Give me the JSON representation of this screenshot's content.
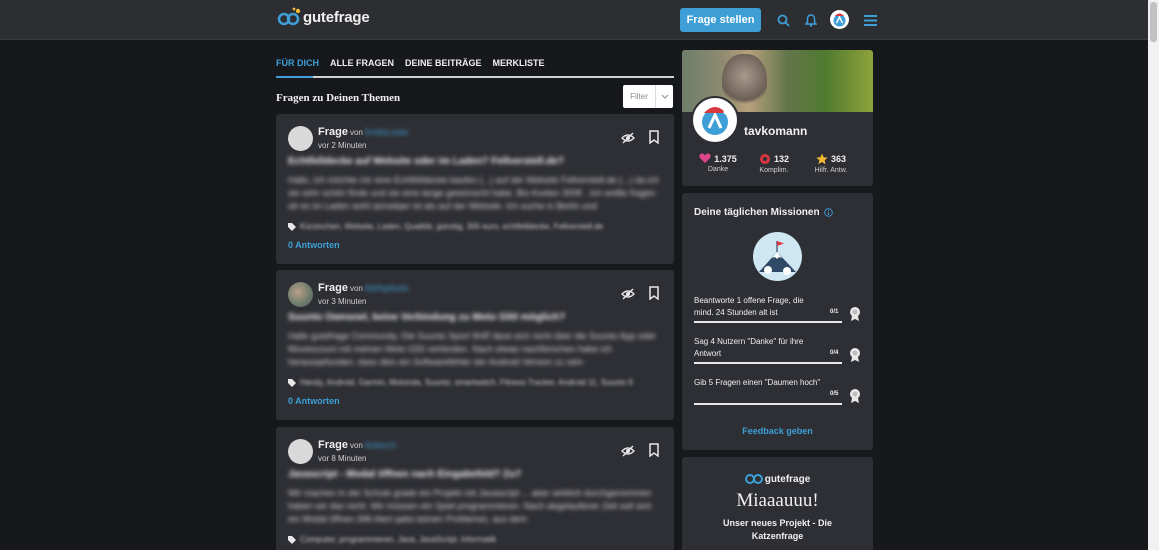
{
  "header": {
    "logo_text": "gutefrage",
    "ask_button": "Frage stellen"
  },
  "tabs": [
    "FÜR DICH",
    "ALLE FRAGEN",
    "DEINE BEITRÄGE",
    "MERKLISTE"
  ],
  "feed": {
    "title": "Fragen zu Deinen Themen",
    "filter_label": "Filter"
  },
  "questions": [
    {
      "type": "Frage",
      "von": "von",
      "user": "EmilieLeider",
      "time": "vor 2 Minuten",
      "title": "Echtfelldecke auf Website oder im Laden? Fellverstell.de?",
      "body": "Hallo, ich möchte mir eine Echtfelldecke kaufen (...) auf der Website Fellverstell.de (...) da ich sie sehr schön finde und sie eine lange gewünscht habe. Bis Kosten 300€ . Ich wollte fragen ob es im Laden wohl günstiger ist als auf der Website. Ich suche in Berlin und",
      "tags": "Kürzinchen, Website, Laden, Qualität, günstig, 300 euro, echtfelldecke, Fellverstell.de",
      "answers": "0 Antworten"
    },
    {
      "type": "Frage",
      "von": "von",
      "user": "BikRiglikette",
      "time": "vor 3 Minuten",
      "title": "Suunto Ownsnel, keine Verbindung zu Moto G50 möglich?",
      "body": "Hallo gutefrage Community, Die Suunto Sport 9HR lässt sich nicht über die Suunto App oder Movescount mit meinen Moto G50 verbinden. Nach etwas nachforschen habe ich herausgefunden, dass dies ein Softwarefehler der Android Version zu sein",
      "tags": "Handy, Android, Garmin, Motorola, Suunto, smartwatch, Fitness Tracker, Android 11, Suunto 9",
      "answers": "0 Antworten"
    },
    {
      "type": "Frage",
      "von": "von",
      "user": "Bobby15",
      "time": "vor 8 Minuten",
      "title": "Javascript - Modal öffnen nach Eingabefeld? Zu?",
      "body": "Wir machen in der Schule grade ein Projekt mit Javascript ... aber wirklich durchgenommen haben wir das nicht. Wir müssen ein Spiel programmieren. Nach abgelaufener Zeit soll sich ein Modal öffnen (Mit Alert gabs keinen Probleme), aus dem",
      "tags": "Computer, programmieren, Java, JavaScript, Informatik",
      "answers": "0 Antworten"
    }
  ],
  "profile": {
    "name": "tavkomann",
    "stats": [
      {
        "value": "1.375",
        "label": "Danke"
      },
      {
        "value": "132",
        "label": "Komplim."
      },
      {
        "value": "363",
        "label": "Hilfr. Antw."
      }
    ]
  },
  "missions": {
    "title": "Deine täglichen Missionen",
    "items": [
      {
        "text": "Beantworte 1 offene Frage, die mind. 24 Stunden alt ist",
        "count": "0/1",
        "progress": 0
      },
      {
        "text": "Sag 4 Nutzern \"Danke\" für ihre Antwort",
        "count": "0/4",
        "progress": 0
      },
      {
        "text": "Gib 5 Fragen einen \"Daumen hoch\"",
        "count": "0/5",
        "progress": 0
      }
    ],
    "feedback": "Feedback geben"
  },
  "promo": {
    "logo_text": "gutefrage",
    "title": "Miaaauuu!",
    "subtitle": "Unser neues Projekt - Die Katzenfrage"
  },
  "colors": {
    "accent": "#3d9fd6",
    "background": "#17181c",
    "card": "#2e2f34",
    "topbar": "#2d2e32"
  }
}
